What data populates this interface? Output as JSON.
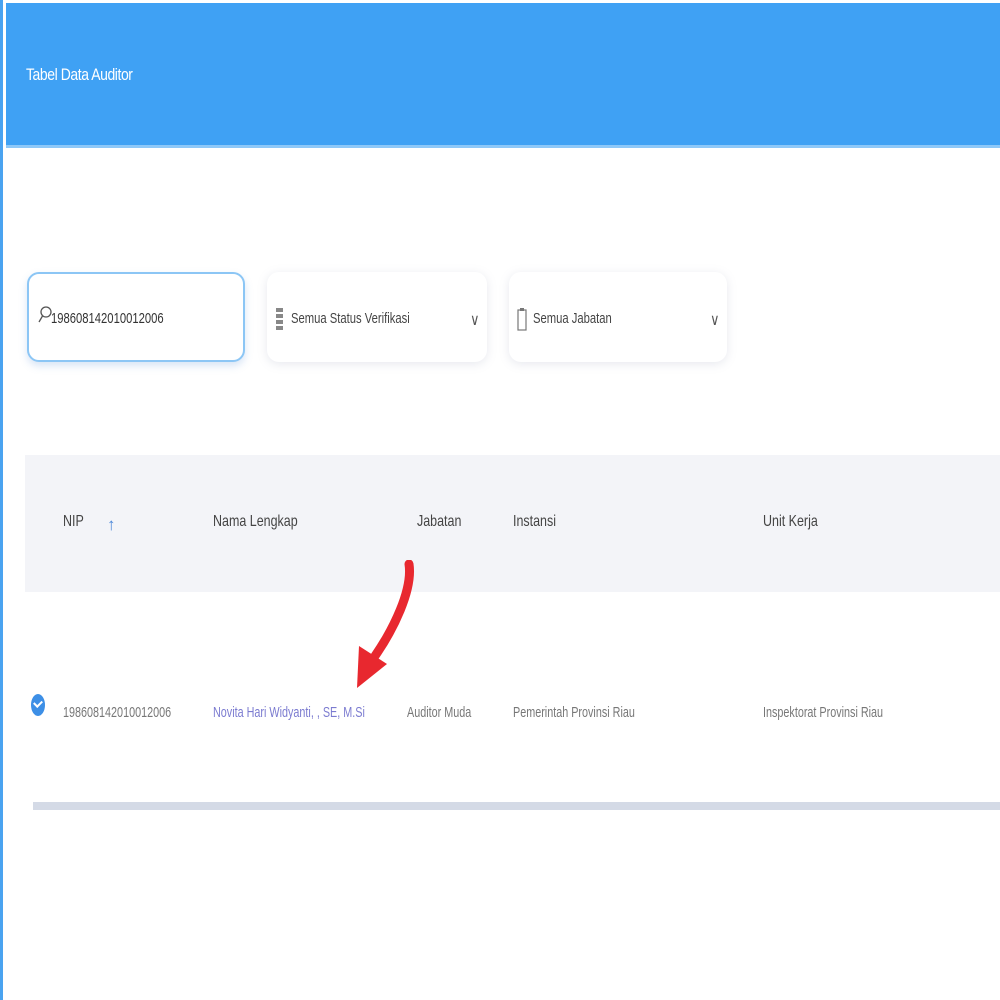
{
  "header": {
    "title": "Tabel Data Auditor"
  },
  "filters": {
    "search_value": "198608142010012006",
    "status_label": "Semua Status Verifikasi",
    "jabatan_label": "Semua Jabatan"
  },
  "table": {
    "columns": [
      "NIP",
      "Nama Lengkap",
      "Jabatan",
      "Instansi",
      "Unit Kerja"
    ],
    "rows": [
      {
        "nip": "198608142010012006",
        "nama": "Novita Hari Widyanti, , SE, M.Si",
        "jabatan": "Auditor Muda",
        "instansi": "Pemerintah Provinsi Riau",
        "unit_kerja": "Inspektorat Provinsi Riau"
      }
    ]
  },
  "colors": {
    "header_bg": "#3fa1f4",
    "accent": "#3d8fe6",
    "annotation_arrow": "#e8282f"
  },
  "icons": {
    "search": "search-icon",
    "status": "list-icon",
    "jabatan": "clipboard-icon",
    "sort": "sort-up-icon",
    "verified": "check-circle-icon",
    "dropdown": "chevron-down-icon"
  }
}
